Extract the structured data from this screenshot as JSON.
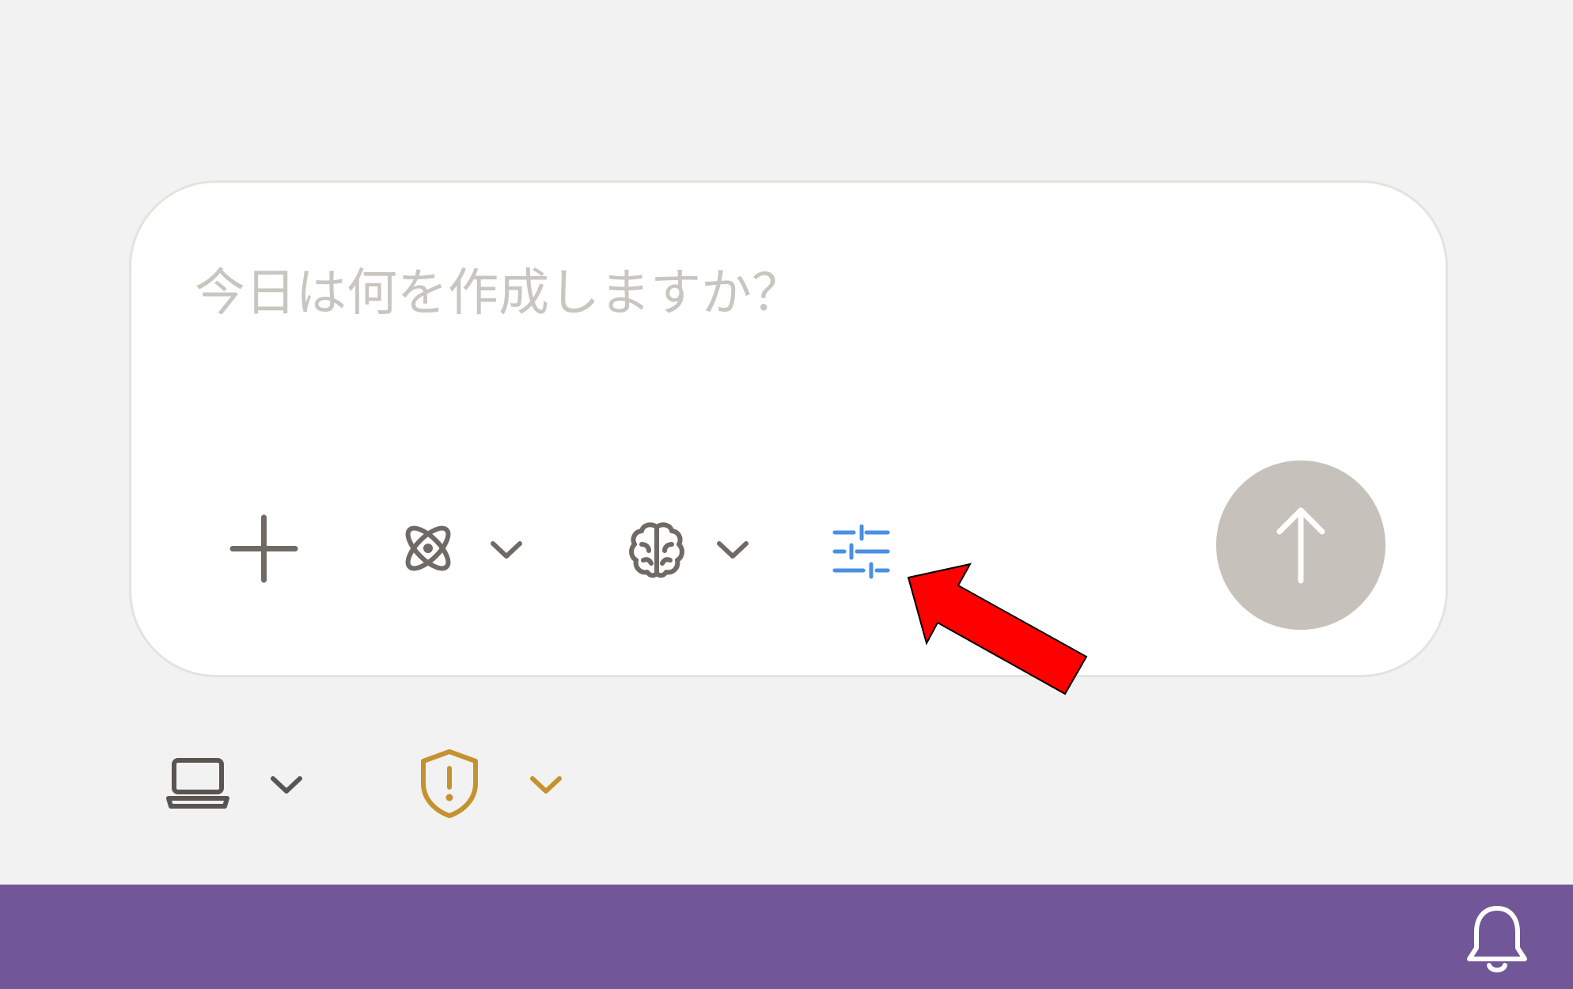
{
  "composer": {
    "placeholder": "今日は何を作成しますか？",
    "value": ""
  },
  "toolbar": {
    "icons": [
      "plus-icon",
      "atom-icon",
      "chevron-down-icon",
      "brain-icon",
      "chevron-down-icon",
      "sliders-icon",
      "arrow-up-icon"
    ],
    "accent_color": "#4a90e2",
    "send_button_color": "#c6c1bb"
  },
  "below_controls": {
    "icons": [
      "laptop-icon",
      "chevron-down-icon",
      "shield-alert-icon",
      "chevron-down-icon"
    ],
    "warning_color": "#c4922e"
  },
  "footer": {
    "icon": "bell-icon",
    "color": "#725798"
  },
  "annotation": {
    "icon": "red-arrow",
    "color": "#ff0000"
  }
}
